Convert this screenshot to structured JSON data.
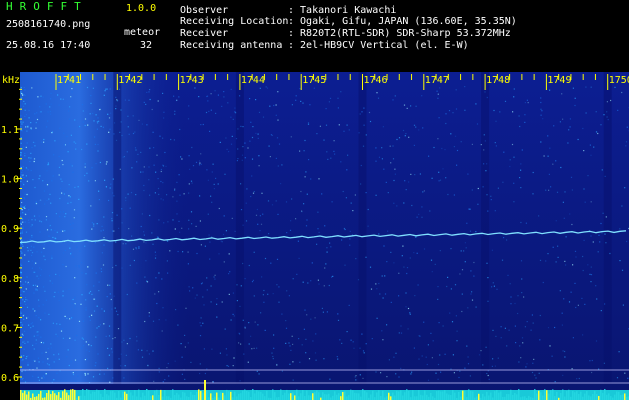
{
  "header": {
    "app_title": "HROFFT",
    "version": "1.0.0",
    "filename": "2508161740.png",
    "meteor_label": "meteor",
    "datetime": "25.08.16 17:40",
    "meteor_count": "32",
    "info": [
      {
        "label": "Observer",
        "value": ": Takanori Kawachi"
      },
      {
        "label": "Receiving Location",
        "value": ": Ogaki, Gifu, JAPAN (136.60E, 35.35N)"
      },
      {
        "label": "Receiver",
        "value": ": R820T2(RTL-SDR) SDR-Sharp 53.372MHz"
      },
      {
        "label": "Receiving antenna",
        "value": ": 2el-HB9CV Vertical (el. E-W)"
      }
    ]
  },
  "spectrogram": {
    "y_unit": "kHz",
    "time_labels": [
      "1741",
      "1742",
      "1743",
      "1744",
      "1745",
      "1746",
      "1747",
      "1748",
      "1749",
      "1750"
    ],
    "freq_labels": [
      "1.1",
      "1.0",
      "0.9",
      "0.8",
      "0.7",
      "0.6"
    ],
    "colors": {
      "background": "#0a1a88",
      "noise": "#2aa0ff",
      "trace": "#7fe0ff",
      "tick_text": "#ffff00",
      "grid": "#ffffff"
    }
  }
}
